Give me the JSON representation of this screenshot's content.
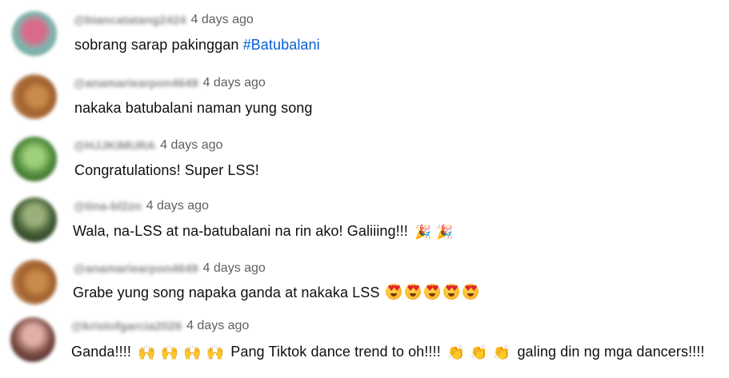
{
  "comments": [
    {
      "handle": "@biancatatang2424",
      "time": "4 days ago",
      "text": "sobrang sarap pakinggan ",
      "hashtag": "#Batubalani"
    },
    {
      "handle": "@anamariearpon4649",
      "time": "4 days ago",
      "text": "nakaka batubalani naman yung song"
    },
    {
      "handle": "@HJJKIMURA",
      "time": "4 days ago",
      "text": "Congratulations! Super LSS!"
    },
    {
      "handle": "@tina-bl2zn",
      "time": "4 days ago",
      "text": "Wala, na-LSS at na-batubalani na rin ako! Galiiing!!! "
    },
    {
      "handle": "@anamariearpon4649",
      "time": "4 days ago",
      "text": "Grabe yung song napaka ganda at nakaka LSS "
    },
    {
      "handle": "@kristofgarcia2026",
      "time": "4 days ago",
      "text_part1": "Ganda!!!! ",
      "text_part2": " Pang Tiktok dance trend to oh!!!! ",
      "text_part3": " galing din ng mga dancers!!!!"
    }
  ],
  "emoji": {
    "party": "🎉",
    "raised_hands": "🙌",
    "clap": "👏"
  }
}
